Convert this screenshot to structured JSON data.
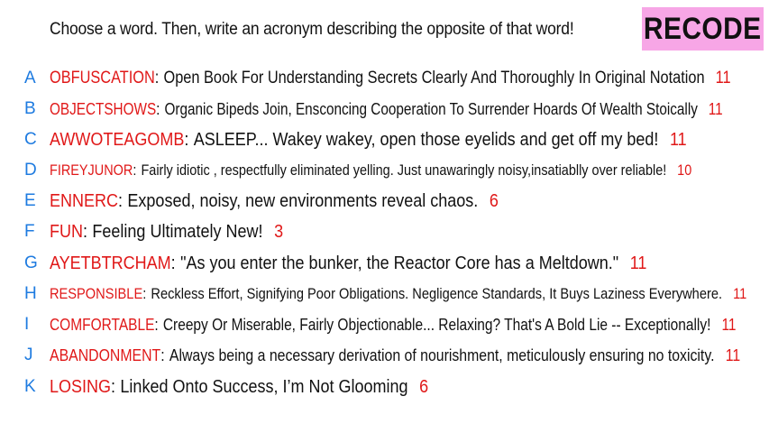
{
  "prompt": "Choose a word. Then, write an acronym describing the opposite of that word!",
  "logo": "RECODE",
  "colors": {
    "letter": "#1e7be0",
    "word": "#e01818",
    "score": "#e01818",
    "logo_bg": "#f7a6e6"
  },
  "entries": [
    {
      "letter": "A",
      "word": "OBFUSCATION",
      "acronym": "Open Book For Understanding Secrets Clearly And Thoroughly In Original Notation",
      "score": "11"
    },
    {
      "letter": "B",
      "word": "OBJECTSHOWS",
      "acronym": "Organic Bipeds Join, Ensconcing Cooperation To Surrender Hoards Of Wealth Stoically",
      "score": "11"
    },
    {
      "letter": "C",
      "word": "AWWOTEAGOMB",
      "acronym": "ASLEEP... Wakey wakey, open those eyelids and get off my bed!",
      "score": "11"
    },
    {
      "letter": "D",
      "word": "FIREYJUNOR",
      "acronym": "Fairly idiotic , respectfully eliminated yelling. Just unawaringly noisy,insatiablly over reliable!",
      "score": "10"
    },
    {
      "letter": "E",
      "word": "ENNERC",
      "acronym": "Exposed, noisy, new environments reveal chaos.",
      "score": "6"
    },
    {
      "letter": "F",
      "word": "FUN",
      "acronym": "Feeling Ultimately New!",
      "score": "3"
    },
    {
      "letter": "G",
      "word": "AYETBTRCHAM",
      "acronym": "\"As you enter the bunker, the Reactor Core has a Meltdown.\"",
      "score": "11"
    },
    {
      "letter": "H",
      "word": "RESPONSIBLE",
      "acronym": "Reckless Effort, Signifying Poor Obligations. Negligence Standards, It Buys Laziness Everywhere.",
      "score": "11"
    },
    {
      "letter": "I",
      "word": "COMFORTABLE",
      "acronym": "Creepy Or Miserable, Fairly Objectionable... Relaxing? That's A Bold Lie -- Exceptionally!",
      "score": "11"
    },
    {
      "letter": "J",
      "word": "ABANDONMENT",
      "acronym": "Always being a necessary derivation of nourishment, meticulously ensuring no toxicity.",
      "score": "11"
    },
    {
      "letter": "K",
      "word": "LOSING",
      "acronym": "Linked Onto Success, I’m Not Glooming",
      "score": "6"
    }
  ]
}
